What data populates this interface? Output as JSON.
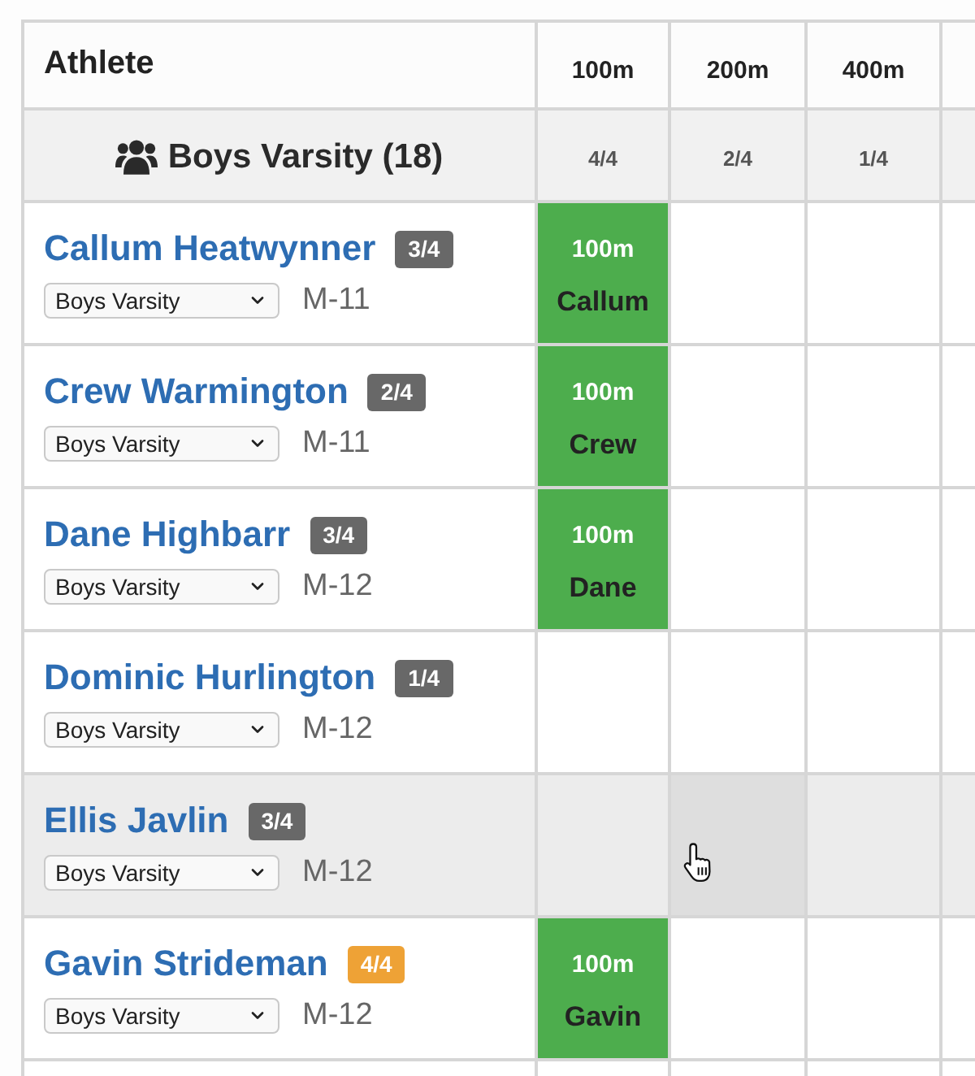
{
  "table": {
    "columns": [
      {
        "label": "Athlete"
      },
      {
        "label": "100m"
      },
      {
        "label": "200m"
      },
      {
        "label": "400m"
      }
    ],
    "group": {
      "name": "Boys Varsity (18)",
      "counts": [
        "4/4",
        "2/4",
        "1/4"
      ]
    },
    "rows": [
      {
        "name": "Callum Heatwynner",
        "badge": {
          "text": "3/4",
          "color": "#686868"
        },
        "team": "Boys Varsity",
        "code": "M-11",
        "hovered": false,
        "cells": [
          {
            "kind": "entry",
            "event": "100m",
            "athlete": "Callum",
            "hovered": false
          },
          {
            "kind": "empty",
            "hovered": false
          },
          {
            "kind": "empty",
            "hovered": false
          }
        ]
      },
      {
        "name": "Crew Warmington",
        "badge": {
          "text": "2/4",
          "color": "#686868"
        },
        "team": "Boys Varsity",
        "code": "M-11",
        "hovered": false,
        "cells": [
          {
            "kind": "entry",
            "event": "100m",
            "athlete": "Crew",
            "hovered": false
          },
          {
            "kind": "empty",
            "hovered": false
          },
          {
            "kind": "empty",
            "hovered": false
          }
        ]
      },
      {
        "name": "Dane Highbarr",
        "badge": {
          "text": "3/4",
          "color": "#686868"
        },
        "team": "Boys Varsity",
        "code": "M-12",
        "hovered": false,
        "cells": [
          {
            "kind": "entry",
            "event": "100m",
            "athlete": "Dane",
            "hovered": false
          },
          {
            "kind": "empty",
            "hovered": false
          },
          {
            "kind": "empty",
            "hovered": false
          }
        ]
      },
      {
        "name": "Dominic Hurlington",
        "badge": {
          "text": "1/4",
          "color": "#686868"
        },
        "team": "Boys Varsity",
        "code": "M-12",
        "hovered": false,
        "cells": [
          {
            "kind": "empty",
            "hovered": false
          },
          {
            "kind": "empty",
            "hovered": false
          },
          {
            "kind": "empty",
            "hovered": false
          }
        ]
      },
      {
        "name": "Ellis Javlin",
        "badge": {
          "text": "3/4",
          "color": "#686868"
        },
        "team": "Boys Varsity",
        "code": "M-12",
        "hovered": true,
        "cells": [
          {
            "kind": "empty",
            "hovered": false
          },
          {
            "kind": "empty",
            "hovered": true
          },
          {
            "kind": "empty",
            "hovered": false
          }
        ]
      },
      {
        "name": "Gavin Strideman",
        "badge": {
          "text": "4/4",
          "color": "#eea236"
        },
        "team": "Boys Varsity",
        "code": "M-12",
        "hovered": false,
        "cells": [
          {
            "kind": "entry",
            "event": "100m",
            "athlete": "Gavin",
            "hovered": false
          },
          {
            "kind": "empty",
            "hovered": false
          },
          {
            "kind": "empty",
            "hovered": false
          }
        ]
      }
    ]
  }
}
